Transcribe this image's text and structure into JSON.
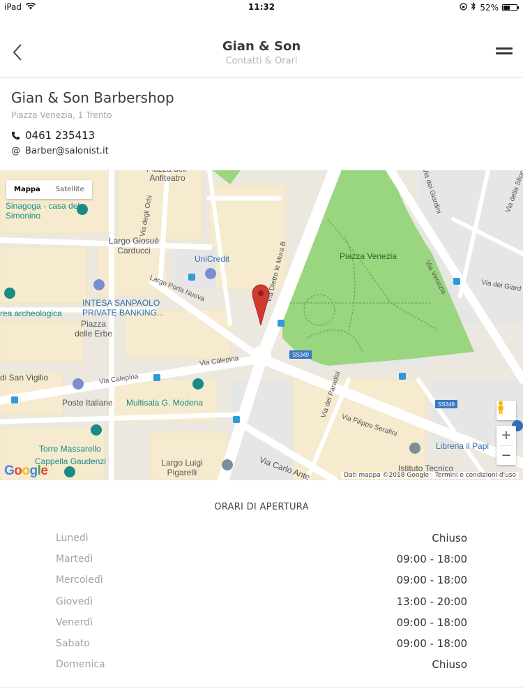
{
  "status_bar": {
    "device": "iPad",
    "time": "11:32",
    "battery": "52%",
    "battery_level": 0.52
  },
  "header": {
    "title": "Gian & Son",
    "subtitle": "Contatti & Orari",
    "back_icon": "chevron-left-icon",
    "menu_icon": "hamburger-menu-icon"
  },
  "shop": {
    "name": "Gian & Son Barbershop",
    "address": "Piazza Venezia, 1 Trento",
    "phone": "0461 235413",
    "email": "Barber@salonist.it"
  },
  "map": {
    "type_toggle": {
      "map": "Mappa",
      "satellite": "Satellite",
      "selected": "Mappa"
    },
    "labels": {
      "anfiteatro": "Piazza dell' Anfiteatro",
      "sinagoga": "Sinagoga - casa del Simonino",
      "via_degli_orbi": "Via degli Orbi",
      "largo_carducci": "Largo Giosuè Carducci",
      "unicredit": "UniCredit",
      "via_dietro_le_mura": "Via Dietro le Mura B",
      "largo_porta_nuova": "Largo Porta Nuova",
      "intesa": "INTESA SANPAOLO PRIVATE BANKING...",
      "area_archeologica": "rea archeologica",
      "piazza_erbe": "Piazza delle Erbe",
      "piazza_venezia": "Piazza Venezia",
      "via_venezia": "Via Venezia",
      "via_dei_giardini": "Via dei Giardini",
      "via_della_sfiocca": "Via della Sfiocca",
      "via_calepina": "Via Calepina",
      "san_vigilio": "di San Vigilio",
      "poste": "Poste Italiane",
      "multisala": "Multisala G. Modena",
      "ss349": "SS349",
      "via_dei_paradisi": "Via dei Paradisi",
      "via_filippo_serafini": "Via Filippo Serafini",
      "torre": "Torre Massarello",
      "cappella": "Cappella Gaudenzi",
      "largo_pigarelli": "Largo Luigi Pigarelli",
      "via_carlo": "Via Carlo Ante",
      "libreria": "Libreria il Papi",
      "istituto": "Istituto Tecnico",
      "via_dei_giard_right": "Via dei Giard"
    },
    "zoom_in": "+",
    "zoom_out": "−",
    "google": "Google",
    "attribution": "Dati mappa ©2018 Google",
    "terms": "Termini e condizioni d'uso"
  },
  "hours": {
    "title": "ORARI DI APERTURA",
    "days": [
      {
        "day": "Lunedì",
        "time": "Chiuso"
      },
      {
        "day": "Martedì",
        "time": "09:00 - 18:00"
      },
      {
        "day": "Mercoledì",
        "time": "09:00 - 18:00"
      },
      {
        "day": "Giovedì",
        "time": "13:00 - 20:00"
      },
      {
        "day": "Venerdì",
        "time": "09:00 - 18:00"
      },
      {
        "day": "Sabato",
        "time": "09:00 - 18:00"
      },
      {
        "day": "Domenica",
        "time": "Chiuso"
      }
    ]
  },
  "colors": {
    "park": "#9ad57f",
    "road": "#ffffff",
    "block": "#f5e9cc",
    "pin": "#d33a2f",
    "poi_blue": "#2f6fb3",
    "poi_teal": "#1a8a85"
  }
}
